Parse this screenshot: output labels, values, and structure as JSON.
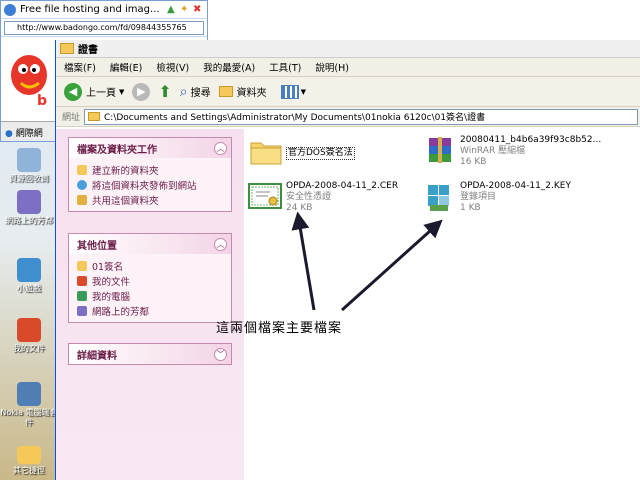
{
  "browser": {
    "title": "Free file hosting and imag...",
    "url": "http://www.badongo.com/fd/09844355765",
    "tab_label": "網際網"
  },
  "desktop": {
    "icons": [
      {
        "label": "資源回收筒"
      },
      {
        "label": "網路上的芳鄰"
      },
      {
        "label": "小遊戲"
      },
      {
        "label": "我的文件"
      },
      {
        "label": "Nokia 電腦端套件"
      },
      {
        "label": "其它捷徑"
      }
    ]
  },
  "explorer": {
    "title": "證書",
    "menu": [
      "檔案(F)",
      "編輯(E)",
      "檢視(V)",
      "我的最愛(A)",
      "工具(T)",
      "說明(H)"
    ],
    "toolbar": {
      "back": "上一頁",
      "search": "搜尋",
      "folders": "資料夾"
    },
    "address_label": "網址",
    "address": "C:\\Documents and Settings\\Administrator\\My Documents\\01nokia 6120c\\01簽名\\證書"
  },
  "tasks": {
    "file_tasks": {
      "header": "檔案及資料夾工作",
      "items": [
        "建立新的資料夾",
        "將這個資料夾發佈到網站",
        "共用這個資料夾"
      ]
    },
    "other_places": {
      "header": "其他位置",
      "items": [
        "01簽名",
        "我的文件",
        "我的電腦",
        "網路上的芳鄰"
      ]
    },
    "details": {
      "header": "詳細資料"
    }
  },
  "files": [
    {
      "name": "官方DOS簽名法",
      "type": "",
      "size": ""
    },
    {
      "name": "20080411_b4b6a39f93c8b52...",
      "type": "WinRAR 壓縮檔",
      "size": "16 KB"
    },
    {
      "name": "OPDA-2008-04-11_2.CER",
      "type": "安全性憑證",
      "size": "24 KB"
    },
    {
      "name": "OPDA-2008-04-11_2.KEY",
      "type": "登錄項目",
      "size": "1 KB"
    }
  ],
  "annotation": "這兩個檔案主要檔案",
  "colors": {
    "accent": "#6b1d47",
    "taskpane": "#f6e0ef",
    "arrow": "#1a1a2e"
  }
}
